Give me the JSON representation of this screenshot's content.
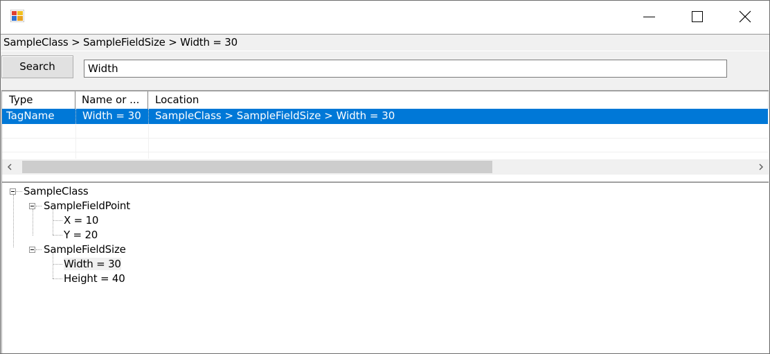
{
  "window": {
    "title": "",
    "controls": {
      "minimize": "minimize-icon",
      "maximize": "maximize-icon",
      "close": "close-icon"
    }
  },
  "path_label": "SampleClass > SampleFieldSize > Width = 30",
  "search": {
    "button_label": "Search",
    "value": "Width"
  },
  "results": {
    "columns": [
      "Type",
      "Name or ...",
      "Location"
    ],
    "rows": [
      {
        "type": "TagName",
        "name": "Width = 30",
        "location": "SampleClass > SampleFieldSize > Width = 30",
        "selected": true
      }
    ]
  },
  "tree": {
    "root": "SampleClass",
    "groups": [
      {
        "label": "SampleFieldPoint",
        "children": [
          "X = 10",
          "Y = 20"
        ]
      },
      {
        "label": "SampleFieldSize",
        "children": [
          "Width = 30",
          "Height = 40"
        ]
      }
    ],
    "selected": "Width = 30"
  },
  "colors": {
    "selection": "#0078d7",
    "window_bg": "#f0f0f0",
    "scroll_thumb": "#cdcdcd"
  }
}
